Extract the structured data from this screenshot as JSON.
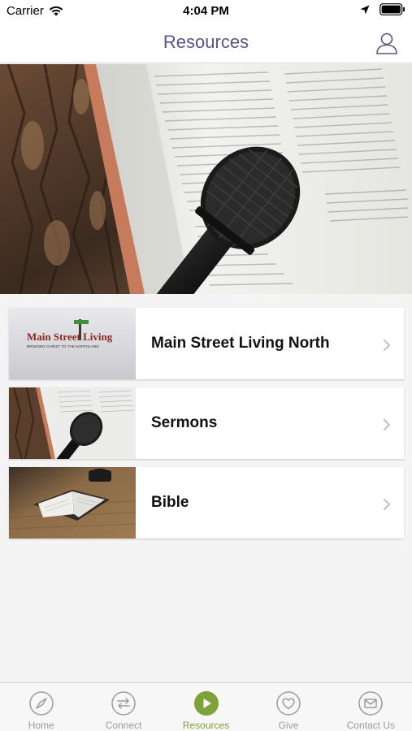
{
  "status_bar": {
    "carrier": "Carrier",
    "time": "4:04 PM"
  },
  "nav": {
    "title": "Resources"
  },
  "resources": [
    {
      "label": "Main Street Living North",
      "logo_text": "Main Street Living",
      "logo_tagline": "BRINGING CHRIST TO THE NORTHLAND"
    },
    {
      "label": "Sermons"
    },
    {
      "label": "Bible"
    }
  ],
  "tabs": [
    {
      "label": "Home",
      "icon": "compass-icon"
    },
    {
      "label": "Connect",
      "icon": "arrows-icon"
    },
    {
      "label": "Resources",
      "icon": "play-icon",
      "active": true
    },
    {
      "label": "Give",
      "icon": "heart-icon"
    },
    {
      "label": "Contact Us",
      "icon": "mail-icon"
    }
  ],
  "colors": {
    "title": "#5a5489",
    "accent": "#7da338",
    "inactive": "#9b9b9b"
  }
}
